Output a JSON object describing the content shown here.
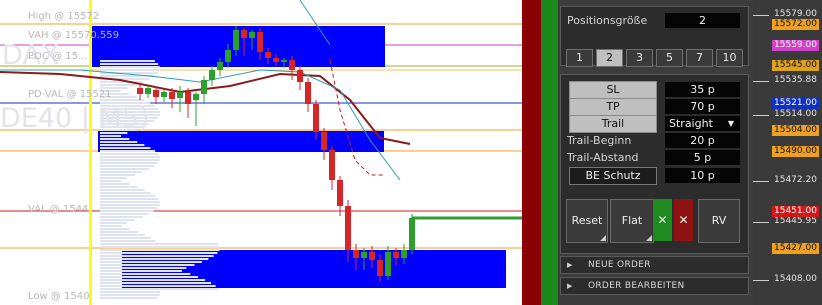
{
  "chart": {
    "watermark_symbol": "DAX",
    "watermark_instrument": "DE40 | M5)",
    "level_labels": {
      "high": "High @ 15572",
      "vah": "VAH @ 15570.559",
      "poc": "POC @ 15...",
      "pd_val": "PD-VAL @ 15521",
      "val": "VAL @ 1544",
      "low": "Low @ 1540"
    }
  },
  "panel": {
    "position_size_label": "Positionsgröße",
    "position_size_value": "2",
    "size_options": [
      "1",
      "2",
      "3",
      "5",
      "7",
      "10"
    ],
    "selected_size": "2",
    "sl_label": "SL",
    "sl_value": "35 p",
    "tp_label": "TP",
    "tp_value": "70 p",
    "trail_label": "Trail",
    "trail_mode": "Straight",
    "trail_start_label": "Trail-Beginn",
    "trail_start_value": "20 p",
    "trail_distance_label": "Trail-Abstand",
    "trail_distance_value": "5 p",
    "be_label": "BE Schutz",
    "be_value": "10 p",
    "reset_label": "Reset",
    "flat_label": "Flat",
    "close_green_label": "✕",
    "close_red_label": "✕",
    "rv_label": "RV",
    "new_order_label": "NEUE ORDER",
    "edit_order_label": "ORDER BEARBEITEN"
  },
  "price_scale": {
    "labels": [
      "15579.00",
      "15535.88",
      "15514.00",
      "15472.20",
      "15445.95",
      "15408.00"
    ],
    "tags": [
      {
        "value": "15572.00",
        "color": "#f0a020"
      },
      {
        "value": "15559.00",
        "color": "#d040c8"
      },
      {
        "value": "15545.00",
        "color": "#e0a020"
      },
      {
        "value": "15521.00",
        "color": "#1030c0"
      },
      {
        "value": "15504.00",
        "color": "#f0a020"
      },
      {
        "value": "15490.00",
        "color": "#f0a020"
      },
      {
        "value": "15451.00",
        "color": "#d01818"
      },
      {
        "value": "15427.00",
        "color": "#f0a020"
      }
    ]
  },
  "colors": {
    "panel_bg": "#3c3c3c",
    "profile_blue": "#0000ff",
    "bull_candle": "#2ca02c",
    "bear_candle": "#d62728",
    "highlight_yellow": "#ffff00"
  }
}
